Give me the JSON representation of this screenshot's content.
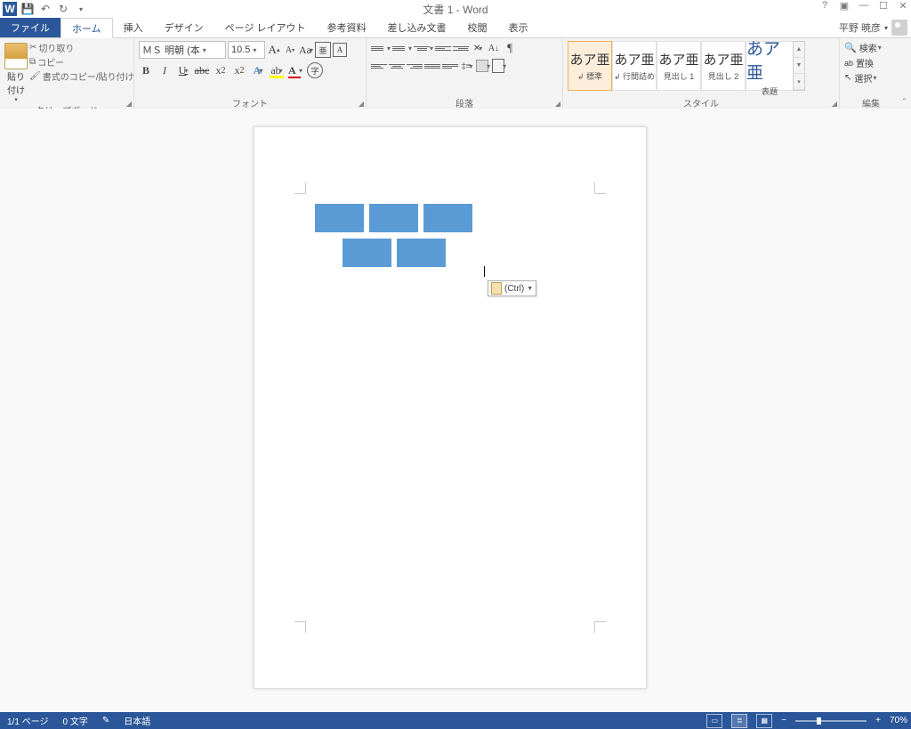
{
  "title": "文書 1 - Word",
  "user": "平野 暁彦",
  "qat": {
    "save": "保存",
    "undo": "元に戻す",
    "redo": "やり直し"
  },
  "tabs": {
    "file": "ファイル",
    "home": "ホーム",
    "insert": "挿入",
    "design": "デザイン",
    "layout": "ページ レイアウト",
    "references": "参考資料",
    "mailings": "差し込み文書",
    "review": "校閲",
    "view": "表示"
  },
  "clipboard": {
    "paste": "貼り付け",
    "cut": "切り取り",
    "copy": "コピー",
    "fmt": "書式のコピー/貼り付け",
    "group": "クリップボード"
  },
  "font": {
    "name": "ＭＳ 明朝 (本",
    "size": "10.5",
    "group": "フォント"
  },
  "para": {
    "group": "段落"
  },
  "styles": {
    "group": "スタイル",
    "items": [
      {
        "preview": "あア亜",
        "label": "↲ 標準"
      },
      {
        "preview": "あア亜",
        "label": "↲ 行間詰め"
      },
      {
        "preview": "あア亜",
        "label": "見出し 1"
      },
      {
        "preview": "あア亜",
        "label": "見出し 2"
      },
      {
        "preview": "あア亜",
        "label": "表題"
      }
    ]
  },
  "editing": {
    "group": "編集",
    "find": "検索",
    "replace": "置換",
    "select": "選択"
  },
  "paste_tag": "(Ctrl)",
  "status": {
    "page": "1/1 ページ",
    "words": "0 文字",
    "lang": "日本語",
    "zoom": "70%"
  }
}
